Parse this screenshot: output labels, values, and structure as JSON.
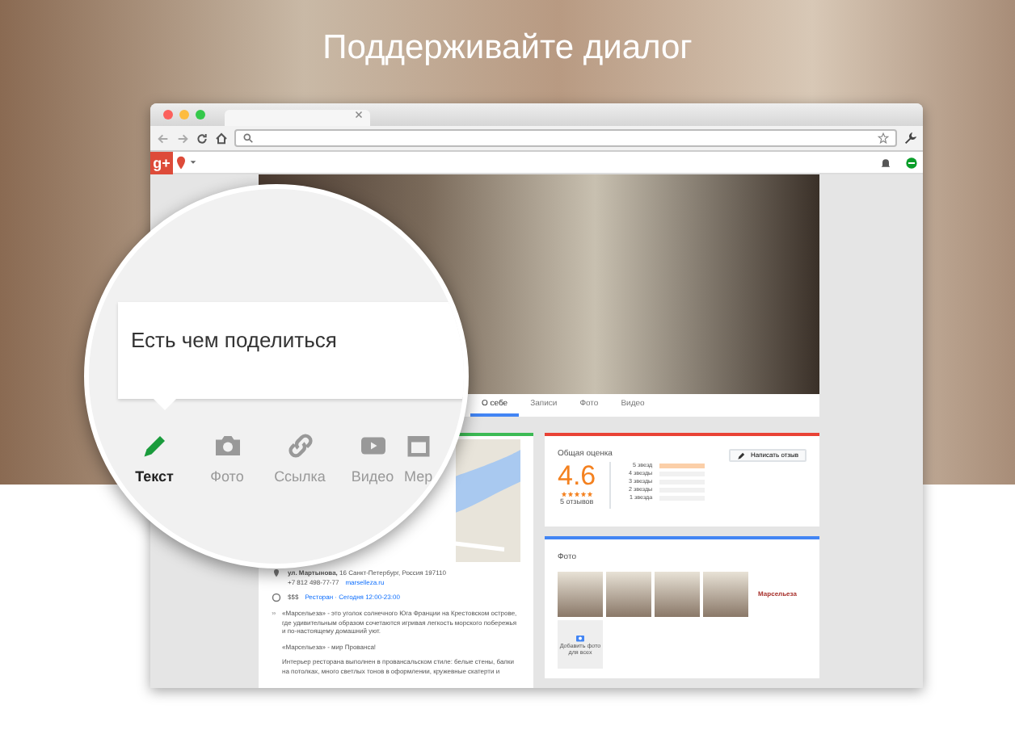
{
  "headline": "Поддерживайте диалог",
  "gplus": {
    "logo": "g+"
  },
  "profile_tabs": [
    {
      "label": "О себе",
      "selected": true
    },
    {
      "label": "Записи",
      "selected": false
    },
    {
      "label": "Фото",
      "selected": false
    },
    {
      "label": "Видео",
      "selected": false
    }
  ],
  "info": {
    "name": "ул. Мартынова,",
    "address": "16 Санкт-Петербург, Россия 197110",
    "phone": "+7 812 498-77-77",
    "website": "marselleza.ru",
    "price": "$$$",
    "category_hours": "Ресторан · Сегодня 12:00-23:00",
    "description": [
      "«Марсельеза» - это уголок солнечного Юга Франции на Крестовском острове, где удивительным образом сочетаются игривая легкость морского побережья и по-настоящему домашний уют.",
      "«Марсельеза» - мир Прованса!",
      "Интерьер ресторана выполнен в провансальском стиле: белые стены, балки на потолках, много светлых тонов в оформлении, кружевные скатерти и"
    ]
  },
  "rating": {
    "title": "Общая оценка",
    "button": "Написать отзыв",
    "score": "4.6",
    "stars": 5,
    "count": "5 отзывов",
    "histogram": [
      {
        "label": "5 звезд",
        "level": 1
      },
      {
        "label": "4 звезды",
        "level": 0
      },
      {
        "label": "3 звезды",
        "level": 0
      },
      {
        "label": "2 звезды",
        "level": 0
      },
      {
        "label": "1 звезда",
        "level": 0
      }
    ]
  },
  "photos": {
    "title": "Фото",
    "items": [
      {
        "kind": "photo"
      },
      {
        "kind": "photo"
      },
      {
        "kind": "photo"
      },
      {
        "kind": "photo"
      },
      {
        "kind": "logo",
        "text": "Марсельеза"
      }
    ],
    "add_label": "Добавить фото для всех"
  },
  "composer": {
    "prompt": "Есть чем поделиться",
    "actions": [
      {
        "kind": "text",
        "label": "Текст",
        "selected": true
      },
      {
        "kind": "photo",
        "label": "Фото",
        "selected": false
      },
      {
        "kind": "link",
        "label": "Ссылка",
        "selected": false
      },
      {
        "kind": "video",
        "label": "Видео",
        "selected": false
      },
      {
        "kind": "event",
        "label": "Мер",
        "selected": false
      }
    ]
  }
}
